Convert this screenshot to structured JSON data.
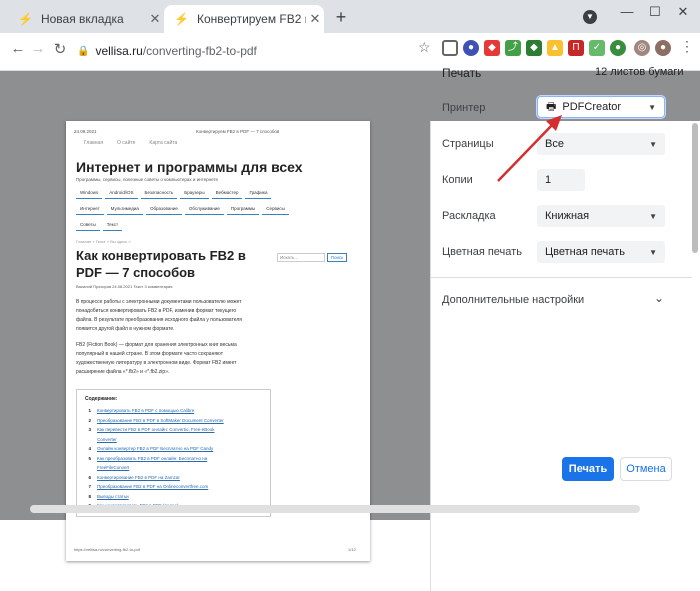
{
  "browser": {
    "tabs": [
      {
        "label": "Новая вкладка"
      },
      {
        "label": "Конвертируем FB2 в PDF — 7 сп"
      }
    ],
    "window_controls": {
      "minimize": "—",
      "maximize": "☐",
      "close": "✕"
    },
    "omnibox": {
      "host": "vellisa.ru",
      "path": "/converting-fb2-to-pdf"
    },
    "extensions": [
      "ext-1",
      "ext-2",
      "ext-3",
      "ext-4",
      "ext-5",
      "ext-6",
      "ext-7",
      "ext-8",
      "ext-9",
      "ext-10"
    ]
  },
  "preview": {
    "date": "24.08.2021",
    "header_title": "Конвертируем FB2 в PDF — 7 способов",
    "top_links": [
      "Главная",
      "О сайте",
      "Карта сайта"
    ],
    "site_title": "Интернет и программы для всех",
    "site_subtitle": "Программы, сервисы, полезные советы о компьютерах и интернете",
    "menu_row1": [
      "Windows",
      "Android/iOS",
      "Безопасность",
      "Браузеры",
      "Вебмастер",
      "Графика"
    ],
    "menu_row2": [
      "Интернет",
      "Мультимедиа",
      "Образование",
      "Обслуживание",
      "Программы",
      "Сервисы"
    ],
    "menu_row3": [
      "Советы",
      "Текст"
    ],
    "breadcrumb": "Главная » Текст » Вы здесь »",
    "article_title_1": "Как конвертировать FB2 в",
    "article_title_2": "PDF — 7 способов",
    "meta": "Василий Прохоров   24.08.2021   Текст   3 комментария",
    "search_placeholder": "Искать...",
    "search_button": "Поиск",
    "para1": [
      "В процессе работы с электронными документами пользователю может",
      "понадобиться конвертировать FB2 в PDF, изменив формат текущего",
      "файла. В результате преобразования исходного файла у пользователя",
      "появится другой файл в нужном формате."
    ],
    "para2": [
      "FB2 (Fiction Book) — формат для хранения электронных книг весьма",
      "популярный в нашей стране. В этом формате часто сохраняют",
      "художественную литературу в электронном виде. Формат FB2 имеет",
      "расширение файла «*.fb2» и «*.fb2.zip»."
    ],
    "toc_title": "Содержание:",
    "toc": [
      {
        "n": "1",
        "text": "Конвертировать FB2 в PDF с помощью Calibre"
      },
      {
        "n": "2",
        "text": "Преобразование FB2 в PDF в SoftMaker Document Converter"
      },
      {
        "n": "3",
        "text": "Как перевести FB2 в PDF онлайн: Convertio, Free-eBook"
      },
      {
        "n": "",
        "text": "Converter"
      },
      {
        "n": "4",
        "text": "Онлайн конвертер FB2 в PDF Бесплатно на PDF Candy"
      },
      {
        "n": "5",
        "text": "Как преобразовать FB2 в PDF онлайн: Бесплатно на"
      },
      {
        "n": "",
        "text": "FreeFileConvert"
      },
      {
        "n": "6",
        "text": "Конвертирование FB2 в PDF на Zamzar"
      },
      {
        "n": "7",
        "text": "Преобразование FB2 в PDF на Onlineconvertfree.com"
      },
      {
        "n": "8",
        "text": "Выводы статьи"
      },
      {
        "n": "9",
        "text": "Как конвертировать FB2 в PDF (видео)"
      }
    ],
    "footer_url": "https://vellisa.ru/converting-fb2-to-pdf",
    "footer_page": "1/12"
  },
  "print_panel": {
    "title": "Печать",
    "sheets": "12 листов бумаги",
    "rows": [
      {
        "label": "Принтер",
        "value": "PDFCreator"
      },
      {
        "label": "Страницы",
        "value": "Все"
      },
      {
        "label": "Копии",
        "value": "1"
      },
      {
        "label": "Раскладка",
        "value": "Книжная"
      },
      {
        "label": "Цветная печать",
        "value": "Цветная печать"
      }
    ],
    "more_settings": "Дополнительные настройки",
    "print_button": "Печать",
    "cancel_button": "Отмена"
  },
  "colors": {
    "accent": "#1a73e8",
    "arrow": "#d32f2f",
    "overlay": "#8e8f90"
  }
}
